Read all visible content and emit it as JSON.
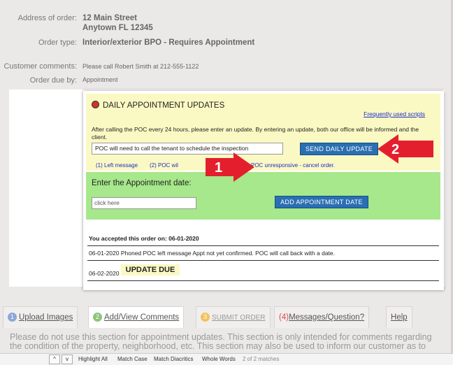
{
  "order": {
    "address_label": "Address of order:",
    "address_line1": "12 Main Street",
    "address_line2": "Anytown FL 12345",
    "type_label": "Order type:",
    "type_value": "Interior/exterior BPO - Requires Appointment",
    "comments_label": "Customer comments:",
    "comments_value": "Please call Robert Smith at 212-555-1122",
    "due_label": "Order due by:",
    "due_value": "Appointment"
  },
  "daily_updates": {
    "title": "DAILY APPOINTMENT UPDATES",
    "scripts_link": "Frequently used scripts",
    "instructions": "After calling the POC every 24 hours, please enter an update. By entering an update, both our office will be informed and the client.",
    "input_value": "POC will need to call the tenant to schedule the inspection",
    "send_button": "SEND DAILY UPDATE",
    "quick_options": [
      "(1) Left message",
      "(2) POC wil",
      "(3) POC unresponsive - cancel order."
    ]
  },
  "appointment": {
    "label": "Enter the Appointment date:",
    "date_placeholder": "click here",
    "add_button": "ADD APPOINTMENT DATE"
  },
  "log": {
    "accepted": "You accepted this order on: 06-01-2020",
    "entry1": "06-01-2020 Phoned POC left message Appt not yet confirmed. POC will call back with a date.",
    "entry2_date": "06-02-2020",
    "entry2_badge": "UPDATE DUE"
  },
  "arrows": {
    "arrow1_label": "1",
    "arrow2_label": "2",
    "color": "#e41f2d"
  },
  "tabs": [
    {
      "num": "1",
      "label": "Upload Images",
      "color": "#8ea6d8"
    },
    {
      "num": "2",
      "label": "Add/View Comments",
      "color": "#8cc47a"
    },
    {
      "num": "3",
      "label": "SUBMIT ORDER",
      "color": "#f2c25c"
    },
    {
      "num": "(4)",
      "label": "Messages/Question?",
      "color": "#e04848"
    },
    {
      "label": "Help"
    }
  ],
  "description": "Please do not use this section for appointment updates. This section is only intended for comments regarding the condition of the property, neighborhood, etc. This section may also be used to inform our customer as to",
  "findbar": {
    "up": "^",
    "down": "v",
    "highlight_all": "Highlight All",
    "match_case": "Match Case",
    "match_diacritics": "Match Diacritics",
    "whole_words": "Whole Words",
    "matches": "2 of 2 matches"
  }
}
